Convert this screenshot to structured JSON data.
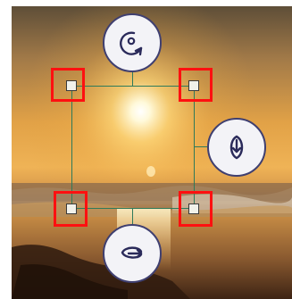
{
  "canvas": {
    "image": "beach-sunset-photo",
    "colors": {
      "sky_top": "#6e5a3e",
      "sky_mid": "#e8a64a",
      "sun_glow": "#fff6d0",
      "sea": "#8a6a48",
      "sand": "#6b4426",
      "frame_line": "#2f7a5a",
      "highlight": "#ff1010",
      "button_border": "#3f3f70"
    }
  },
  "transform": {
    "rotate_top_icon": "rotate-clockwise-icon",
    "rotate_right_icon": "rotate-vertical-icon",
    "rotate_bottom_icon": "rotate-horizontal-icon"
  }
}
